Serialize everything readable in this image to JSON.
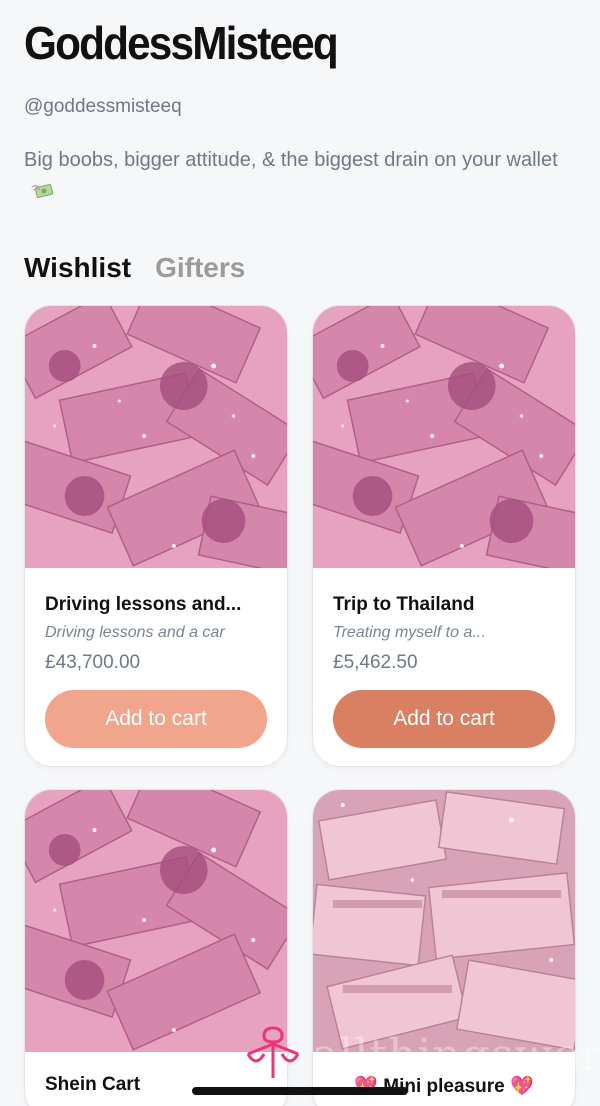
{
  "profile": {
    "name": "GoddessMisteeq",
    "handle": "@goddessmisteeq",
    "bio": "Big boobs, bigger attitude, & the biggest drain on your wallet",
    "bio_icon": "money-with-wings-icon"
  },
  "tabs": [
    {
      "label": "Wishlist",
      "active": true
    },
    {
      "label": "Gifters",
      "active": false
    }
  ],
  "items": [
    {
      "title": "Driving lessons and...",
      "subtitle": "Driving lessons and a car",
      "price": "£43,700.00",
      "button": "Add to cart",
      "button_color": "#f0a58c",
      "image": "pink-money-glitter-image"
    },
    {
      "title": "Trip to Thailand",
      "subtitle": "Treating myself to a...",
      "price": "£5,462.50",
      "button": "Add to cart",
      "button_color": "#d97f62",
      "image": "pink-money-glitter-image"
    },
    {
      "title": "Shein Cart",
      "subtitle": "",
      "price": "",
      "button": "",
      "button_color": "",
      "image": "pink-money-glitter-image"
    },
    {
      "title": "💖 Mini pleasure 💖",
      "subtitle": "",
      "price": "",
      "button": "",
      "button_color": "",
      "image": "pink-money-stacks-image"
    }
  ],
  "watermark": "allthingsworn"
}
